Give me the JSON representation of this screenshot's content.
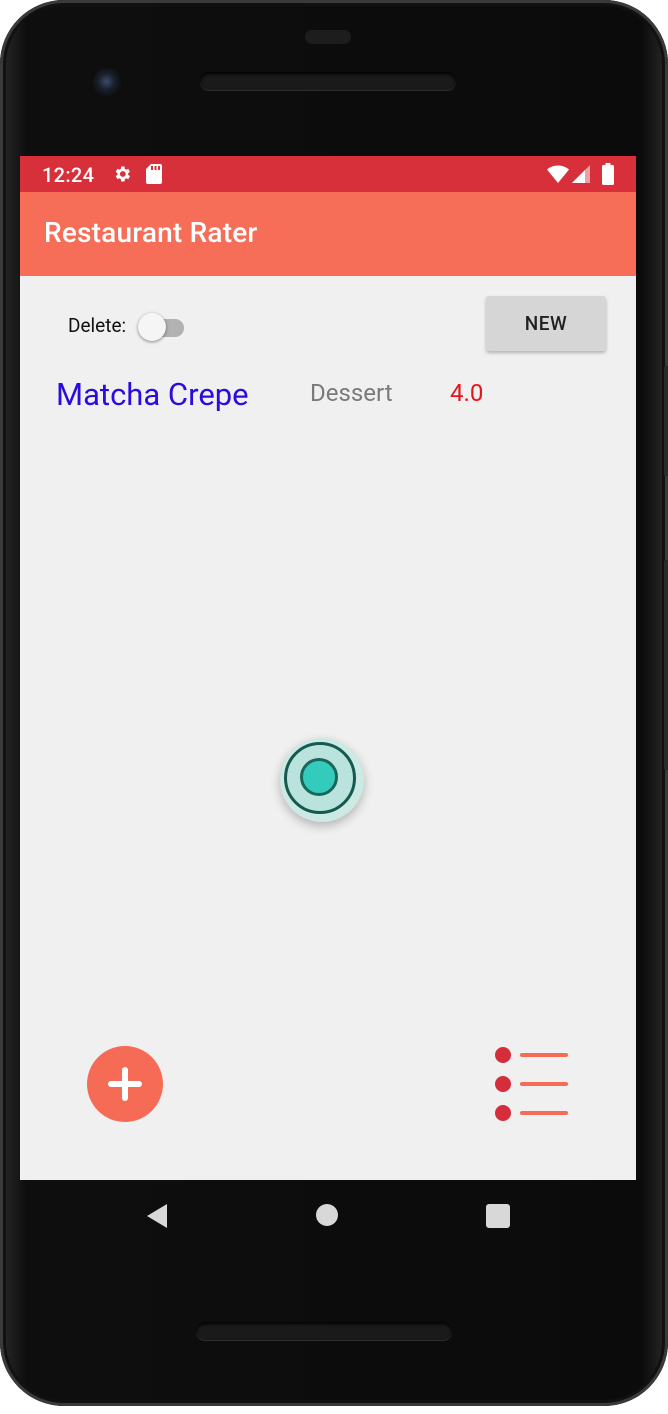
{
  "status_bar": {
    "time": "12:24",
    "icons": [
      "gear-icon",
      "sd-card-icon",
      "wifi-icon",
      "signal-icon",
      "battery-icon"
    ]
  },
  "app_bar": {
    "title": "Restaurant Rater"
  },
  "controls": {
    "delete_label": "Delete:",
    "delete_switch_on": false,
    "new_button_label": "NEW"
  },
  "restaurants": [
    {
      "name": "Matcha Crepe",
      "type": "Dessert",
      "rating": "4.0"
    }
  ],
  "bottom_actions": {
    "add_icon": "plus-icon",
    "list_icon": "list-icon"
  },
  "nav_bar": [
    "back-icon",
    "home-icon",
    "recents-icon"
  ],
  "colors": {
    "status_bar": "#d8303a",
    "app_bar": "#f76e58",
    "name_text": "#2a0be0",
    "rating_text": "#e5141c",
    "accent": "#f56b56"
  }
}
